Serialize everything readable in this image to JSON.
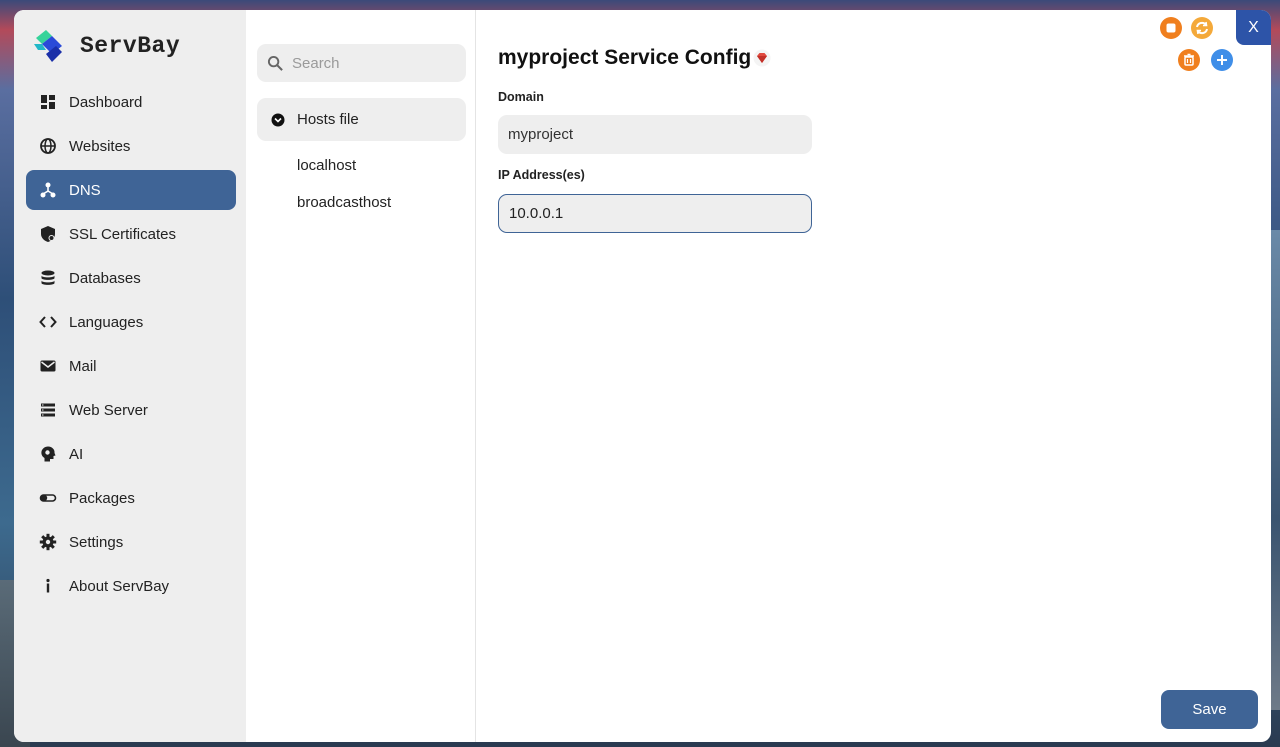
{
  "app": {
    "name": "ServBay"
  },
  "sidebar": {
    "items": [
      {
        "label": "Dashboard",
        "icon": "dashboard-icon"
      },
      {
        "label": "Websites",
        "icon": "globe-icon"
      },
      {
        "label": "DNS",
        "icon": "dns-icon",
        "active": true
      },
      {
        "label": "SSL Certificates",
        "icon": "shield-icon"
      },
      {
        "label": "Databases",
        "icon": "database-icon"
      },
      {
        "label": "Languages",
        "icon": "code-icon"
      },
      {
        "label": "Mail",
        "icon": "mail-icon"
      },
      {
        "label": "Web Server",
        "icon": "server-icon"
      },
      {
        "label": "AI",
        "icon": "brain-icon"
      },
      {
        "label": "Packages",
        "icon": "toggle-icon"
      },
      {
        "label": "Settings",
        "icon": "gear-icon"
      },
      {
        "label": "About ServBay",
        "icon": "info-icon"
      }
    ]
  },
  "list": {
    "search_placeholder": "Search",
    "group_label": "Hosts file",
    "hosts": [
      "localhost",
      "broadcasthost"
    ]
  },
  "main": {
    "title": "myproject Service Config",
    "domain_label": "Domain",
    "domain_value": "myproject",
    "ip_label": "IP Address(es)",
    "ip_value": "10.0.0.1",
    "save_label": "Save"
  },
  "window": {
    "close_label": "X"
  },
  "colors": {
    "accent": "#3f6496",
    "orange": "#f07f1e",
    "blue": "#3f8ee8",
    "close": "#2d54a8"
  }
}
